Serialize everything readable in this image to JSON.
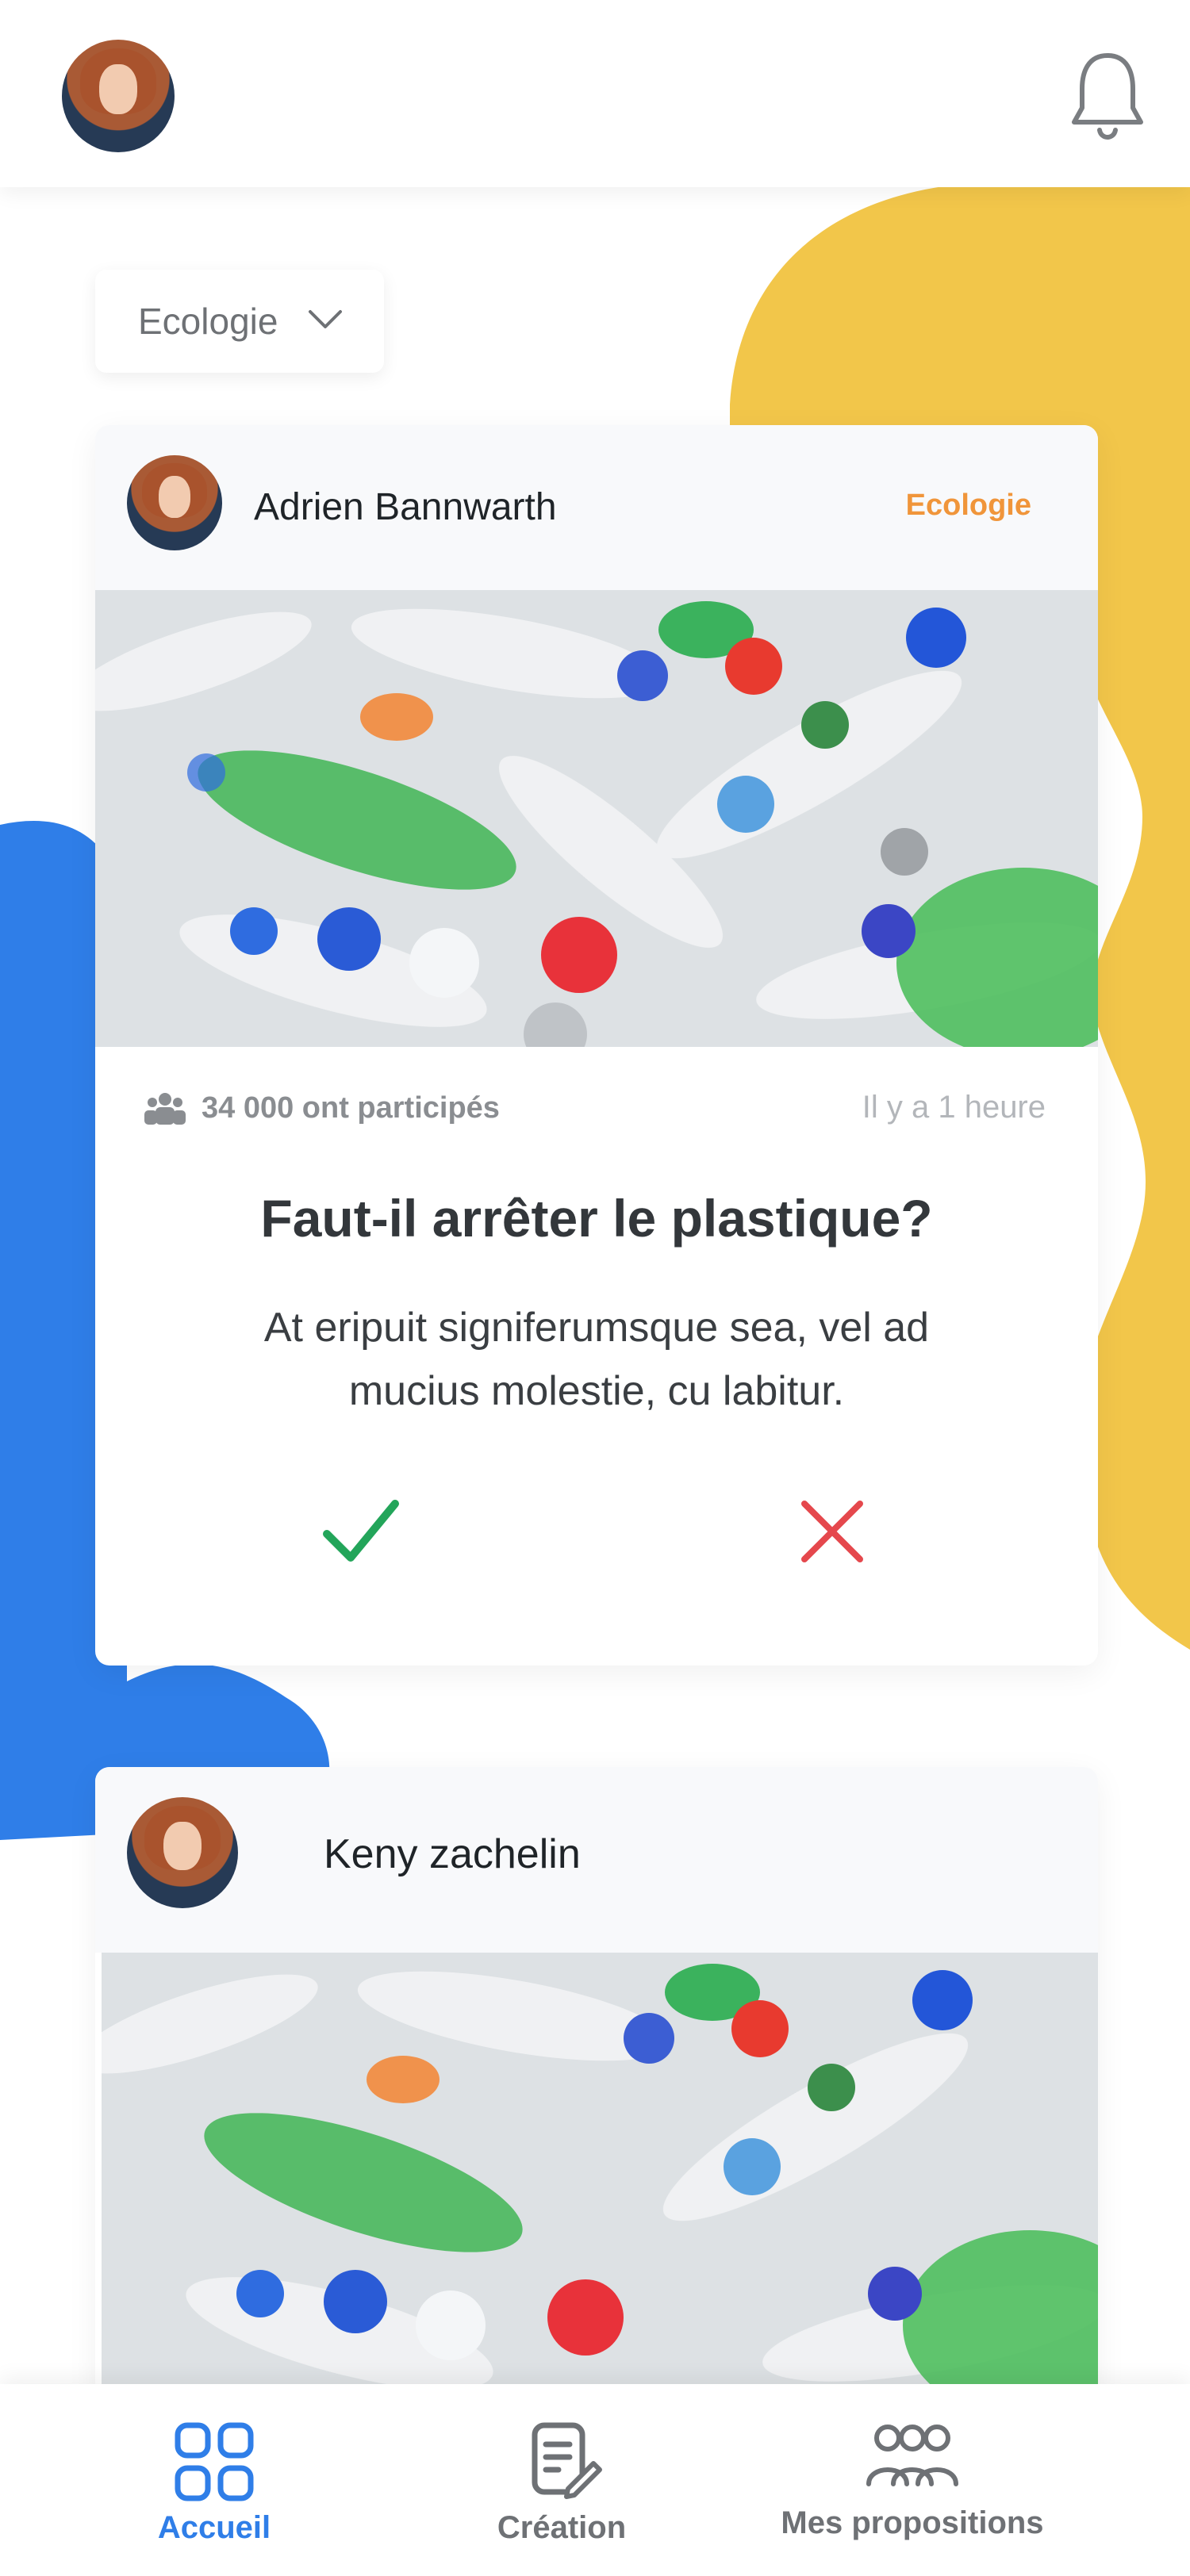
{
  "header": {
    "avatar_icon": "user-avatar",
    "bell_icon": "bell-icon"
  },
  "filter": {
    "label": "Ecologie",
    "icon": "chevron-down-icon"
  },
  "posts": [
    {
      "author": "Adrien Bannwarth",
      "category": "Ecologie",
      "participants": "34 000 ont participés",
      "time": "Il y a 1 heure",
      "question": "Faut-il arrêter le plastique?",
      "description_line1": "At eripuit signiferumsque sea, vel ad",
      "description_line2": "mucius molestie, cu labitur.",
      "approve_icon": "check-icon",
      "reject_icon": "close-icon"
    },
    {
      "author": "Keny zachelin"
    }
  ],
  "nav": {
    "items": [
      {
        "label": "Accueil",
        "icon": "grid-icon",
        "active": true
      },
      {
        "label": "Création",
        "icon": "edit-document-icon",
        "active": false
      },
      {
        "label": "Mes propositions",
        "icon": "group-icon",
        "active": false
      }
    ]
  },
  "colors": {
    "accent_blue": "#2f7ee8",
    "accent_yellow": "#f2c64a",
    "category_orange": "#f0953a",
    "approve_green": "#23a55a",
    "reject_red": "#e5484d"
  }
}
